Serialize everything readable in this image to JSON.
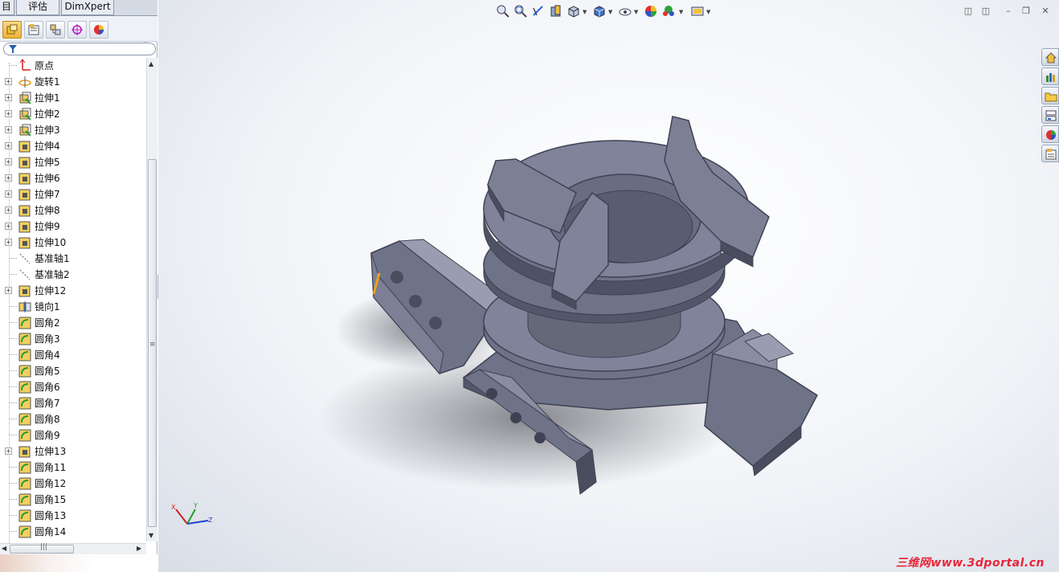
{
  "tabs": [
    {
      "label": "目"
    },
    {
      "label": "评估"
    },
    {
      "label": "DimXpert"
    }
  ],
  "panel_toolbar": {
    "buttons": [
      "feature-manager-icon",
      "property-manager-icon",
      "configuration-manager-icon",
      "dimxpert-manager-icon",
      "display-manager-icon"
    ],
    "more": "»"
  },
  "filter": {
    "icon": "filter-icon"
  },
  "tree": [
    {
      "label": "原点",
      "icon": "origin-icon",
      "expandable": false
    },
    {
      "label": "旋转1",
      "icon": "revolve-icon",
      "expandable": true
    },
    {
      "label": "拉伸1",
      "icon": "extrude-icon",
      "expandable": true
    },
    {
      "label": "拉伸2",
      "icon": "extrude-icon",
      "expandable": true
    },
    {
      "label": "拉伸3",
      "icon": "extrude-icon",
      "expandable": true
    },
    {
      "label": "拉伸4",
      "icon": "cut-extrude-icon",
      "expandable": true
    },
    {
      "label": "拉伸5",
      "icon": "cut-extrude-icon",
      "expandable": true
    },
    {
      "label": "拉伸6",
      "icon": "cut-extrude-icon",
      "expandable": true
    },
    {
      "label": "拉伸7",
      "icon": "cut-extrude-icon",
      "expandable": true
    },
    {
      "label": "拉伸8",
      "icon": "cut-extrude-icon",
      "expandable": true
    },
    {
      "label": "拉伸9",
      "icon": "cut-extrude-icon",
      "expandable": true
    },
    {
      "label": "拉伸10",
      "icon": "cut-extrude-icon",
      "expandable": true
    },
    {
      "label": "基准轴1",
      "icon": "axis-icon",
      "expandable": false
    },
    {
      "label": "基准轴2",
      "icon": "axis-icon",
      "expandable": false
    },
    {
      "label": "拉伸12",
      "icon": "cut-extrude-icon",
      "expandable": true
    },
    {
      "label": "镜向1",
      "icon": "mirror-icon",
      "expandable": false
    },
    {
      "label": "圆角2",
      "icon": "fillet-icon",
      "expandable": false
    },
    {
      "label": "圆角3",
      "icon": "fillet-icon",
      "expandable": false
    },
    {
      "label": "圆角4",
      "icon": "fillet-icon",
      "expandable": false
    },
    {
      "label": "圆角5",
      "icon": "fillet-icon",
      "expandable": false
    },
    {
      "label": "圆角6",
      "icon": "fillet-icon",
      "expandable": false
    },
    {
      "label": "圆角7",
      "icon": "fillet-icon",
      "expandable": false
    },
    {
      "label": "圆角8",
      "icon": "fillet-icon",
      "expandable": false
    },
    {
      "label": "圆角9",
      "icon": "fillet-icon",
      "expandable": false
    },
    {
      "label": "拉伸13",
      "icon": "cut-extrude-icon",
      "expandable": true
    },
    {
      "label": "圆角11",
      "icon": "fillet-icon",
      "expandable": false
    },
    {
      "label": "圆角12",
      "icon": "fillet-icon",
      "expandable": false
    },
    {
      "label": "圆角15",
      "icon": "fillet-icon",
      "expandable": false
    },
    {
      "label": "圆角13",
      "icon": "fillet-icon",
      "expandable": false
    },
    {
      "label": "圆角14",
      "icon": "fillet-icon",
      "expandable": false
    }
  ],
  "view_toolbar": [
    "zoom-to-fit-icon",
    "zoom-area-icon",
    "previous-view-icon",
    "section-view-icon",
    "view-orientation-icon",
    "display-style-icon",
    "hide-show-items-icon",
    "edit-appearance-icon",
    "apply-scene-icon",
    "view-settings-icon"
  ],
  "triad": {
    "x": "X",
    "y": "Y",
    "z": "Z"
  },
  "watermark": "三维网www.3dportal.cn",
  "colors": {
    "model": "#6f7388",
    "model_light": "#9a9db0",
    "model_dark": "#4a4d5e",
    "accent": "#f0a020",
    "watermark": "#e8253a"
  }
}
